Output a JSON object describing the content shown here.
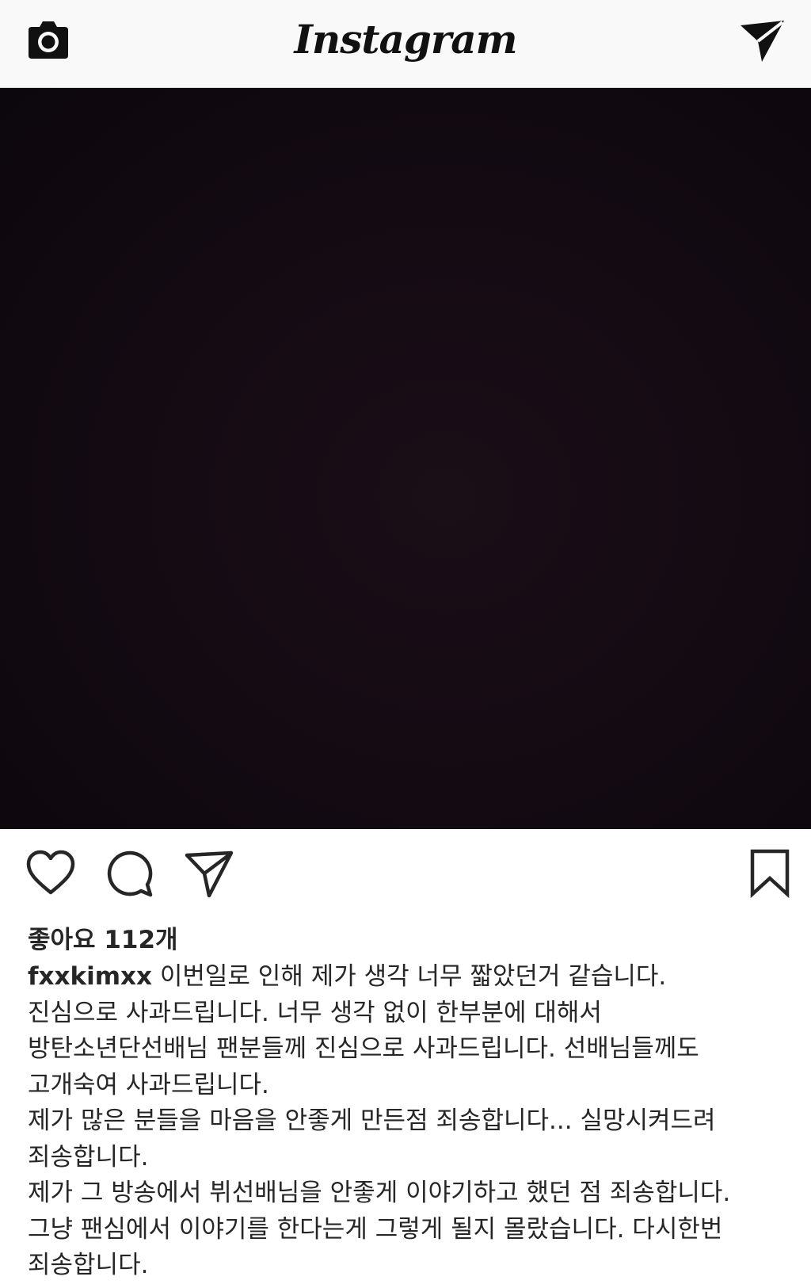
{
  "app": {
    "logo_text": "Instagram"
  },
  "icons": {
    "camera": "camera-icon",
    "direct": "paper-plane-icon",
    "like": "heart-icon",
    "comment": "comment-bubble-icon",
    "share": "paper-plane-icon",
    "save": "bookmark-icon"
  },
  "post": {
    "image_color": "#140b12",
    "likes_text": "좋아요 112개",
    "username": "fxxkimxx",
    "caption_lines": [
      "이번일로 인해 제가 생각 너무 짧았던거 같습니다.",
      "진심으로 사과드립니다. 너무 생각 없이 한부분에 대해서",
      "방탄소년단선배님 팬분들께 진심으로 사과드립니다. 선배님들께도",
      "고개숙여 사과드립니다.",
      "제가 많은 분들을 마음을 안좋게 만든점 죄송합니다... 실망시켜드려",
      "죄송합니다.",
      "제가 그 방송에서 뷔선배님을 안좋게 이야기하고 했던 점 죄송합니다.",
      "그냥 팬심에서 이야기를 한다는게 그렇게 될지 몰랐습니다. 다시한번",
      "죄송합니다."
    ]
  }
}
